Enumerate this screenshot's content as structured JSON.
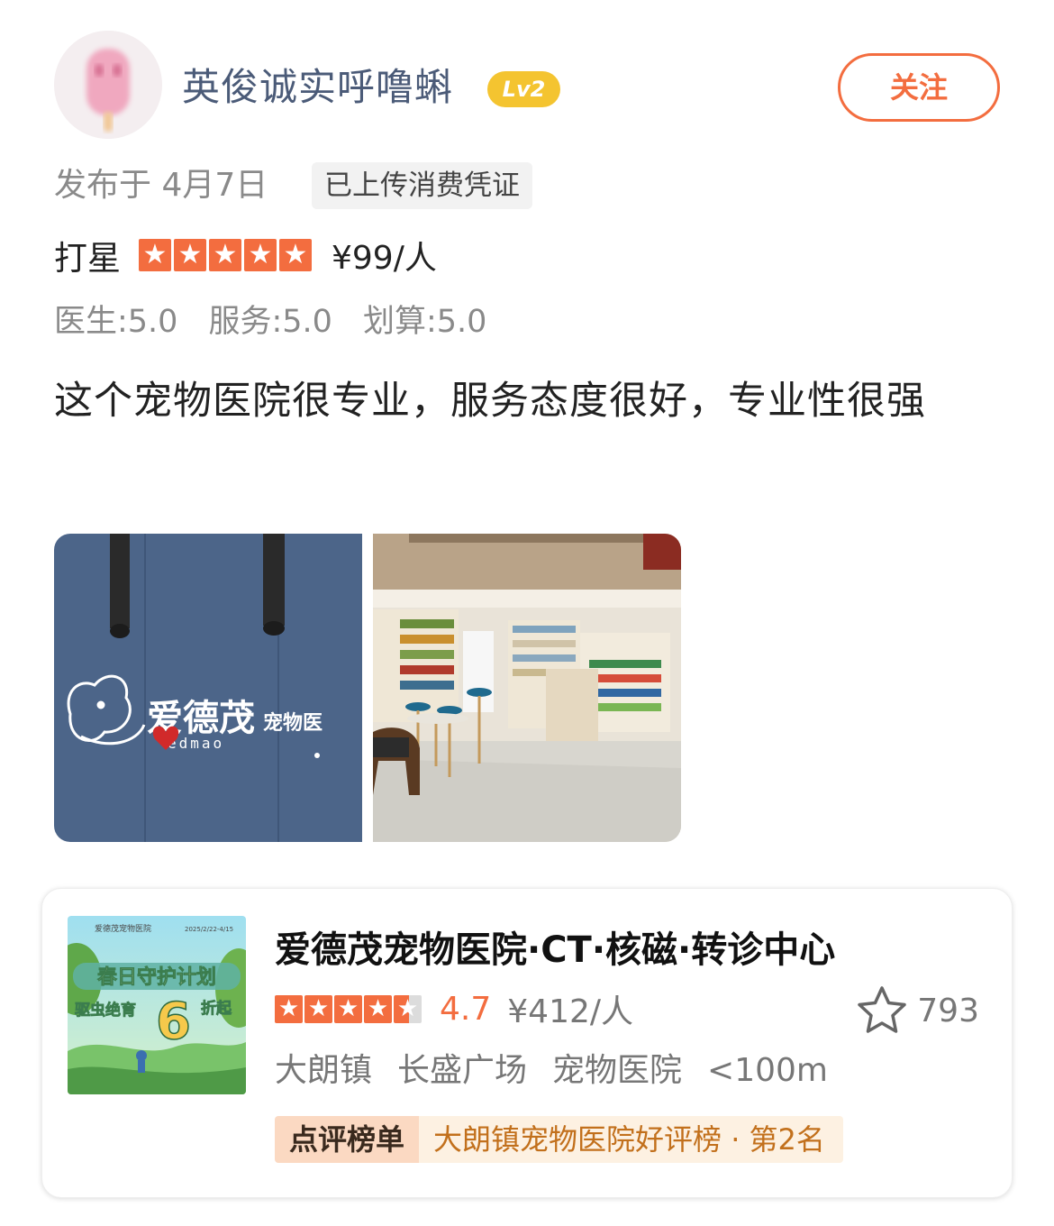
{
  "user": {
    "name": "英俊诚实呼噜蝌",
    "level": "Lv2",
    "follow_label": "关注"
  },
  "post": {
    "published": "发布于 4月7日",
    "receipt_badge": "已上传消费凭证",
    "rating_label": "打星",
    "rating_stars": 5,
    "price": "¥99/人",
    "scores": [
      {
        "label": "医生:5.0"
      },
      {
        "label": "服务:5.0"
      },
      {
        "label": "划算:5.0"
      }
    ],
    "review_text": "这个宠物医院很专业，服务态度很好，专业性很强",
    "photo1_sign": "爱德茂",
    "photo1_sign_sub": "宠物医",
    "photo1_sign_en": "edmao"
  },
  "shop": {
    "name": "爱德茂宠物医院·CT·核磁·转诊中心",
    "stars": 4.5,
    "score": "4.7",
    "price": "¥412/人",
    "favorites": "793",
    "location": [
      "大朗镇",
      "长盛广场",
      "宠物医院",
      "<100m"
    ],
    "rank_tag": "点评榜单",
    "rank_text": "大朗镇宠物医院好评榜 · 第2名",
    "thumb": {
      "brand": "爱德茂宠物医院",
      "date": "2025/2/22-4/15",
      "title": "春日守护计划",
      "promo_left": "驱虫绝育",
      "promo_number": "6",
      "promo_right": "折起"
    }
  },
  "colors": {
    "accent": "#f36d3f",
    "username": "#4b5b78",
    "level_badge": "#f4c430"
  }
}
